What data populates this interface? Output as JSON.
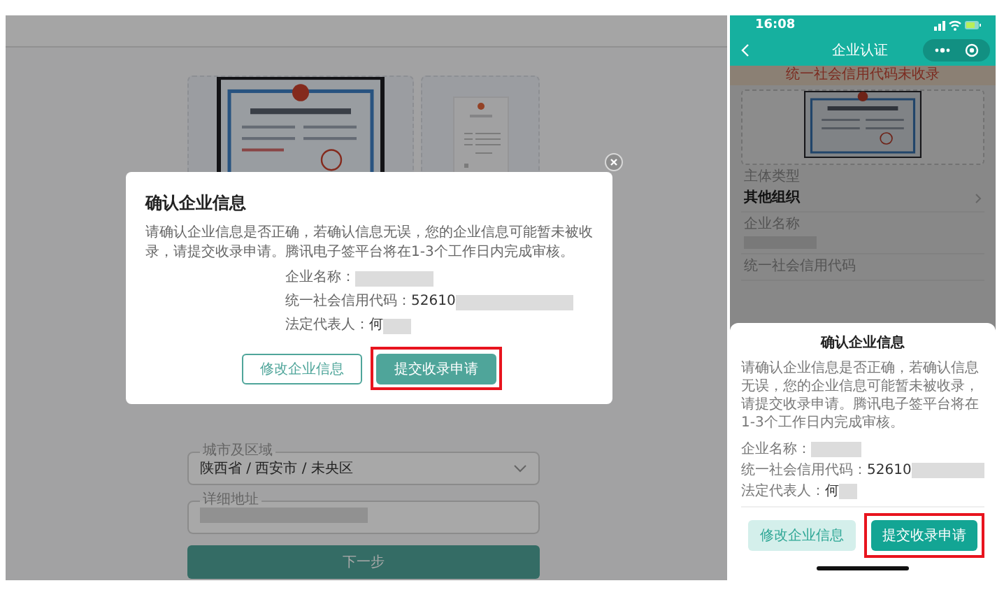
{
  "web": {
    "upload_cards": [
      {
        "kind": "picture"
      },
      {
        "kind": "sample"
      }
    ],
    "address": {
      "label": "城市及区域",
      "value": "陕西省 / 西安市 / 未央区"
    },
    "detail": {
      "label": "详细地址"
    },
    "next_button": "下一步"
  },
  "web_dialog": {
    "title": "确认企业信息",
    "message": "请确认企业信息是否正确，若确认信息无误，您的企业信息可能暂未被收录，请提交收录申请。腾讯电子签平台将在1-3个工作日内完成审核。",
    "fields": [
      {
        "label": "企业名称："
      },
      {
        "label": "统一社会信用代码：",
        "value": "52610"
      },
      {
        "label": "法定代表人：",
        "value": "何"
      }
    ],
    "buttons": [
      {
        "label": "修改企业信息",
        "kind": "secondary",
        "highlighted": false
      },
      {
        "label": "提交收录申请",
        "kind": "primary",
        "highlighted": true
      }
    ]
  },
  "phone": {
    "time": "16:08",
    "title": "企业认证",
    "banner": "统一社会信用代码未收录",
    "fields": [
      {
        "label": "主体类型",
        "value": "其他组织",
        "kind": "select"
      },
      {
        "label": "企业名称",
        "kind": "redacted"
      },
      {
        "label": "统一社会信用代码",
        "kind": "text"
      }
    ]
  },
  "phone_sheet": {
    "title": "确认企业信息",
    "message": "请确认企业信息是否正确，若确认信息无误，您的企业信息可能暂未被收录，请提交收录申请。腾讯电子签平台将在1-3个工作日内完成审核。",
    "fields": [
      {
        "label": "企业名称："
      },
      {
        "label": "统一社会信用代码：",
        "value": "52610"
      },
      {
        "label": "法定代表人：",
        "value": "何"
      }
    ],
    "buttons": [
      {
        "label": "修改企业信息",
        "kind": "secondary",
        "highlighted": false
      },
      {
        "label": "提交收录申请",
        "kind": "primary",
        "highlighted": true
      }
    ]
  }
}
